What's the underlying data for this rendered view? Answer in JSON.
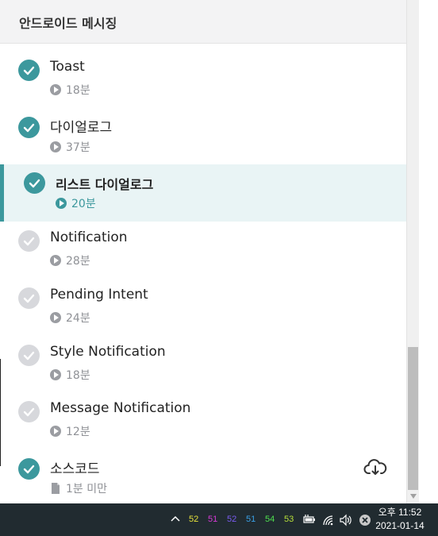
{
  "section": {
    "title": "안드로이드 메시징"
  },
  "lessons": [
    {
      "title": "Toast",
      "duration": "18분",
      "completed": true,
      "active": false,
      "type": "video"
    },
    {
      "title": "다이얼로그",
      "duration": "37분",
      "completed": true,
      "active": false,
      "type": "video"
    },
    {
      "title": "리스트 다이얼로그",
      "duration": "20분",
      "completed": true,
      "active": true,
      "type": "video"
    },
    {
      "title": "Notification",
      "duration": "28분",
      "completed": false,
      "active": false,
      "type": "video"
    },
    {
      "title": "Pending Intent",
      "duration": "24분",
      "completed": false,
      "active": false,
      "type": "video"
    },
    {
      "title": "Style Notification",
      "duration": "18분",
      "completed": false,
      "active": false,
      "type": "video"
    },
    {
      "title": "Message Notification",
      "duration": "12분",
      "completed": false,
      "active": false,
      "type": "video"
    },
    {
      "title": "소스코드",
      "duration": "1분 미만",
      "completed": true,
      "active": false,
      "type": "document"
    }
  ],
  "colors": {
    "accent": "#3c989d",
    "incomplete": "#d7d8dc",
    "active_bg": "#e9f4f5",
    "taskbar": "#212b30"
  },
  "taskbar": {
    "tray_numbers": [
      {
        "value": "52",
        "color": "#e6e23a"
      },
      {
        "value": "51",
        "color": "#d63ad6"
      },
      {
        "value": "52",
        "color": "#7a5cf0"
      },
      {
        "value": "51",
        "color": "#3aa0e6"
      },
      {
        "value": "54",
        "color": "#4ee04e"
      },
      {
        "value": "53",
        "color": "#b8e03a"
      }
    ],
    "time": "오후 11:52",
    "date": "2021-01-14"
  }
}
